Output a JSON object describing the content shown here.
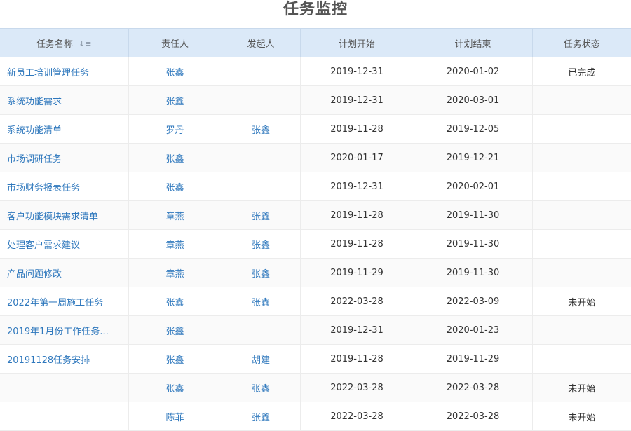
{
  "header": {
    "title": "任务监控"
  },
  "table": {
    "columns": [
      {
        "label": "任务名称",
        "sortable": true
      },
      {
        "label": "责任人"
      },
      {
        "label": "发起人"
      },
      {
        "label": "计划开始"
      },
      {
        "label": "计划结束"
      },
      {
        "label": "任务状态"
      }
    ],
    "rows": [
      {
        "name": "新员工培训管理任务",
        "owner": "张鑫",
        "initiator": "",
        "start": "2019-12-31",
        "end": "2020-01-02",
        "status": "已完成"
      },
      {
        "name": "系统功能需求",
        "owner": "张鑫",
        "initiator": "",
        "start": "2019-12-31",
        "end": "2020-03-01",
        "status": ""
      },
      {
        "name": "系统功能清单",
        "owner": "罗丹",
        "initiator": "张鑫",
        "start": "2019-11-28",
        "end": "2019-12-05",
        "status": ""
      },
      {
        "name": "市场调研任务",
        "owner": "张鑫",
        "initiator": "",
        "start": "2020-01-17",
        "end": "2019-12-21",
        "status": ""
      },
      {
        "name": "市场财务报表任务",
        "owner": "张鑫",
        "initiator": "",
        "start": "2019-12-31",
        "end": "2020-02-01",
        "status": ""
      },
      {
        "name": "客户功能模块需求清单",
        "owner": "章燕",
        "initiator": "张鑫",
        "start": "2019-11-28",
        "end": "2019-11-30",
        "status": ""
      },
      {
        "name": "处理客户需求建议",
        "owner": "章燕",
        "initiator": "张鑫",
        "start": "2019-11-28",
        "end": "2019-11-30",
        "status": ""
      },
      {
        "name": "产品问题修改",
        "owner": "章燕",
        "initiator": "张鑫",
        "start": "2019-11-29",
        "end": "2019-11-30",
        "status": ""
      },
      {
        "name": "2022年第一周施工任务",
        "owner": "张鑫",
        "initiator": "张鑫",
        "start": "2022-03-28",
        "end": "2022-03-09",
        "status": "未开始"
      },
      {
        "name": "2019年1月份工作任务...",
        "owner": "张鑫",
        "initiator": "",
        "start": "2019-12-31",
        "end": "2020-01-23",
        "status": ""
      },
      {
        "name": "20191128任务安排",
        "owner": "张鑫",
        "initiator": "胡建",
        "start": "2019-11-28",
        "end": "2019-11-29",
        "status": ""
      },
      {
        "name": "",
        "owner": "张鑫",
        "initiator": "张鑫",
        "start": "2022-03-28",
        "end": "2022-03-28",
        "status": "未开始"
      },
      {
        "name": "",
        "owner": "陈菲",
        "initiator": "张鑫",
        "start": "2022-03-28",
        "end": "2022-03-28",
        "status": "未开始"
      }
    ]
  },
  "icons": {
    "sort": "sort-descending-icon"
  },
  "colors": {
    "header_bg": "#dbe9f8",
    "link": "#2f78bd",
    "title": "#555555"
  }
}
